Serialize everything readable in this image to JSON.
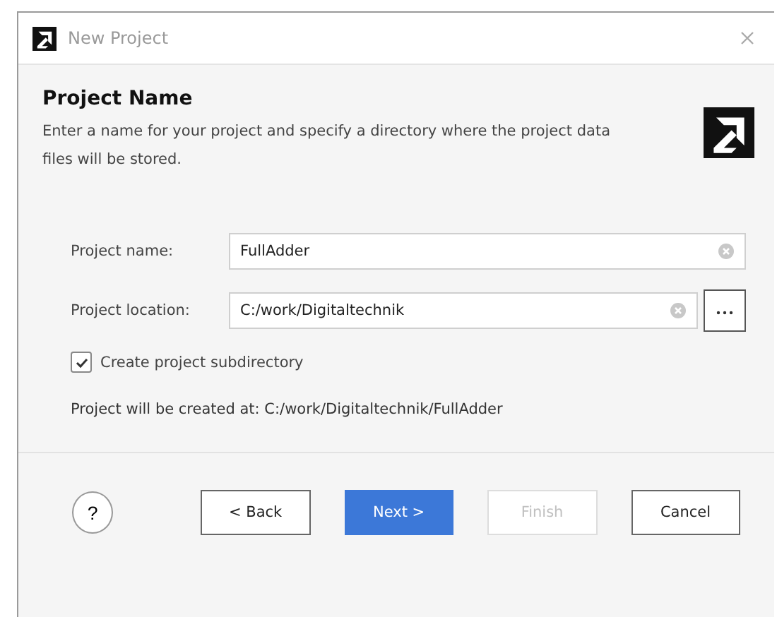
{
  "window": {
    "title": "New Project"
  },
  "header": {
    "title": "Project Name",
    "description": "Enter a name for your project and specify a directory where the project data files will be stored."
  },
  "fields": [
    {
      "label": "Project name:",
      "value": "FullAdder",
      "browse": false
    },
    {
      "label": "Project location:",
      "value": "C:/work/Digitaltechnik",
      "browse": true
    }
  ],
  "checkbox": {
    "label": "Create project subdirectory",
    "checked": true
  },
  "info": "Project will be created at: C:/work/Digitaltechnik/FullAdder",
  "help": {
    "label": "?"
  },
  "buttons": [
    {
      "label": "< Back",
      "default": false,
      "disabled": false
    },
    {
      "label": "Next >",
      "default": true,
      "disabled": false
    },
    {
      "label": "Finish",
      "default": false,
      "disabled": true
    },
    {
      "label": "Cancel",
      "default": false,
      "disabled": false
    }
  ]
}
